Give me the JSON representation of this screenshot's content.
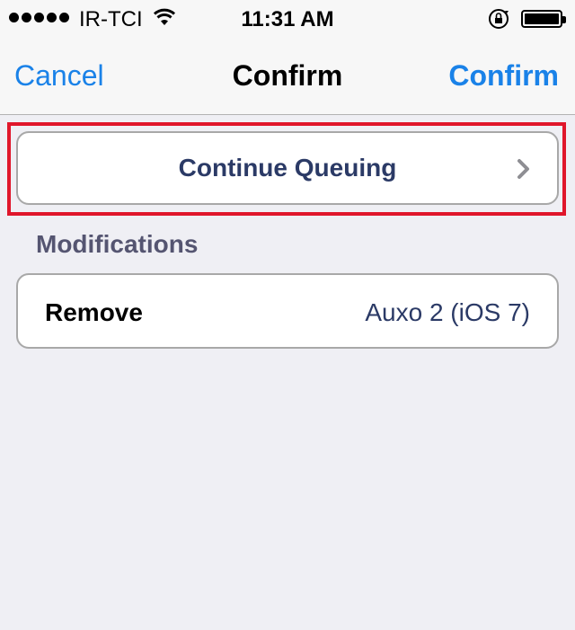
{
  "status_bar": {
    "carrier": "IR-TCI",
    "time": "11:31 AM",
    "signal_bars": 5,
    "icons": [
      "signal-dots-icon",
      "wifi-icon",
      "rotation-lock-icon",
      "battery-icon"
    ]
  },
  "nav": {
    "left_label": "Cancel",
    "title": "Confirm",
    "right_label": "Confirm",
    "accent_color": "#1a82e8"
  },
  "continue": {
    "label": "Continue Queuing",
    "icon": "chevron-right-icon",
    "highlight_color": "#e0162b"
  },
  "modifications": {
    "header": "Modifications",
    "rows": [
      {
        "action": "Remove",
        "package": "Auxo 2 (iOS 7)"
      }
    ]
  }
}
